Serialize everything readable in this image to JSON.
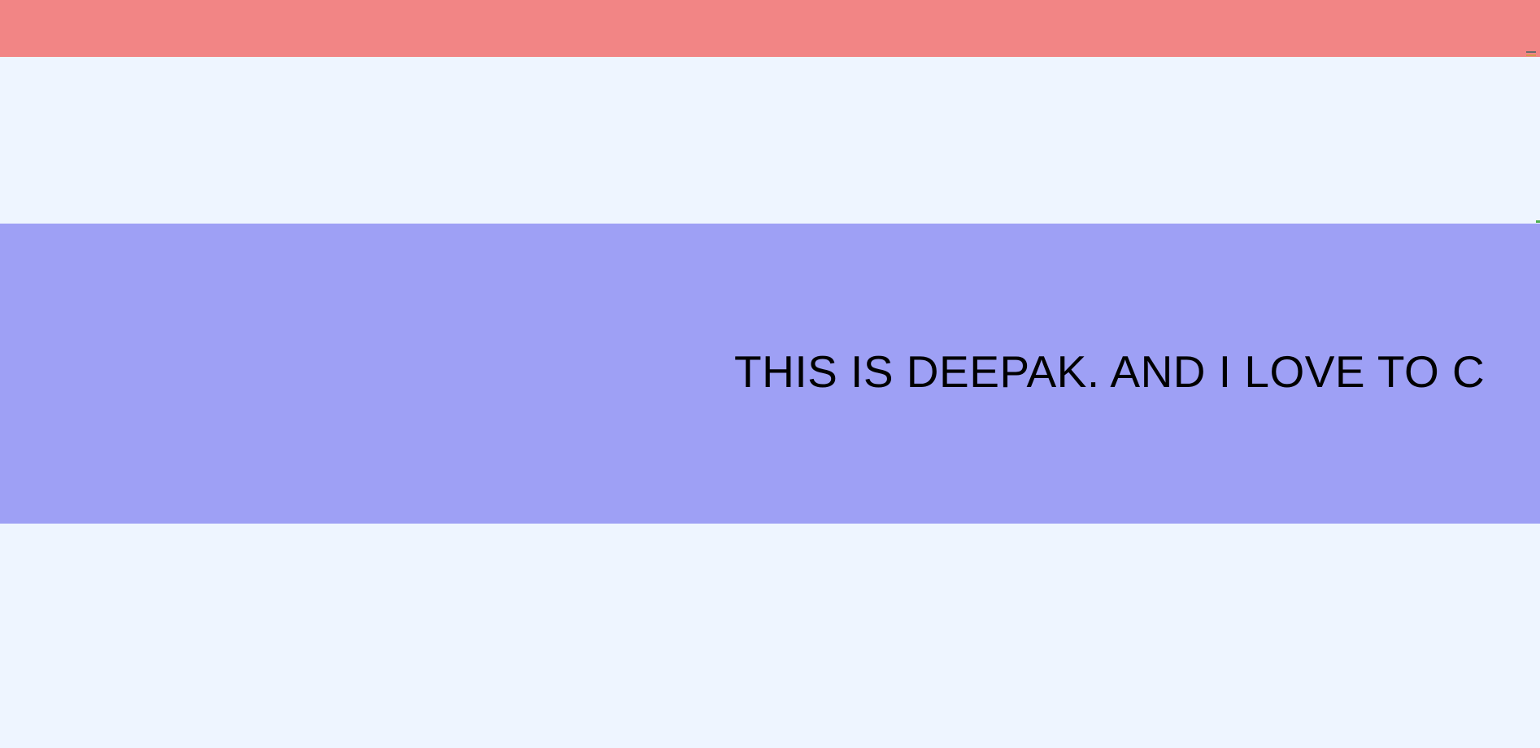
{
  "hero": {
    "text": "THIS IS DEEPAK. AND I LOVE TO C"
  },
  "colors": {
    "top_bar": "#f28585",
    "background": "#eef5ff",
    "hero_band": "#9ea0f5"
  },
  "icons": {
    "menu": "menu-icon",
    "edge_marker": "marker-icon"
  }
}
